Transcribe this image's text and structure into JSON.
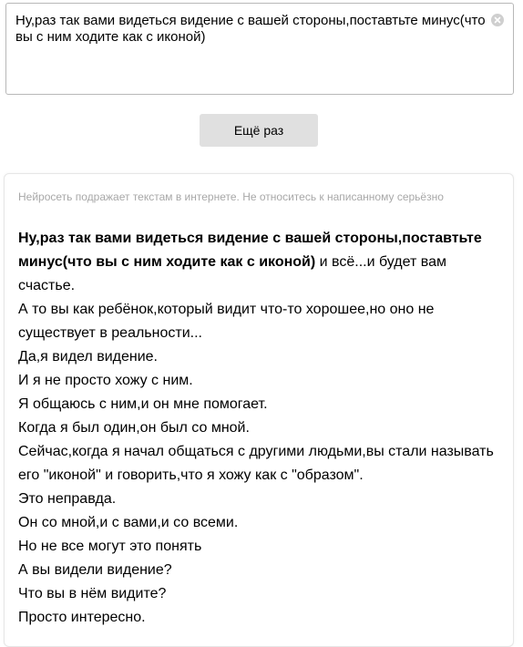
{
  "input": {
    "text": "Ну,раз так вами видеться видение с вашей стороны,поставтьте минус(что вы с ним ходите как с иконой)"
  },
  "again_button": {
    "label": "Ещё раз"
  },
  "result": {
    "disclaimer": "Нейросеть подражает текстам в интернете. Не относитесь к написанному серьёзно",
    "prompt_bold": "Ну,раз так вами видеться видение с вашей стороны,поставтьте минус(что вы с ним ходите как с иконой)",
    "continuation": " и всё...и будет вам счастье.",
    "lines": [
      "А то вы как ребёнок,который видит что-то хорошее,но оно не существует в реальности...",
      "Да,я видел видение.",
      "И я не просто хожу с ним.",
      "Я общаюсь с ним,и он мне помогает.",
      "Когда я был один,он был со мной.",
      "Сейчас,когда я начал общаться с другими людьми,вы стали называть его \"иконой\" и говорить,что я хожу как с \"образом\".",
      "Это неправда.",
      "Он со мной,и с вами,и со всеми.",
      "Но не все могут это понять",
      "А вы видели видение?",
      "Что вы в нём видите?",
      "Просто интересно."
    ]
  }
}
